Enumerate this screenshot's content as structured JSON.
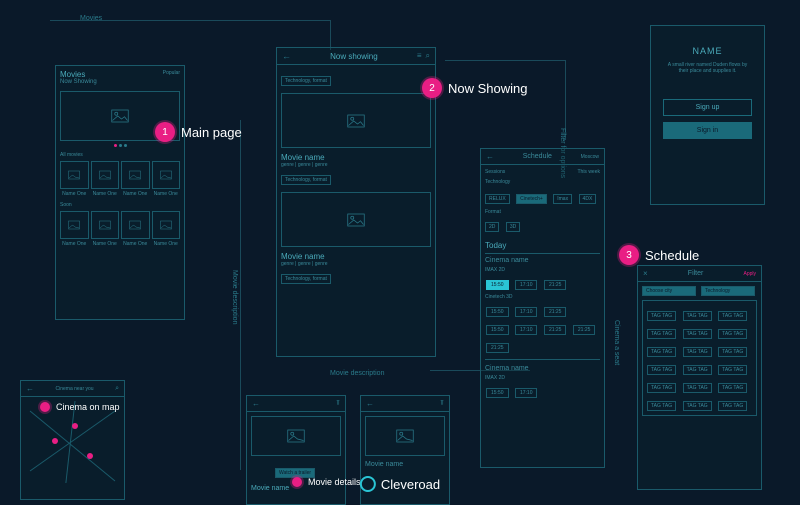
{
  "annotations": {
    "main_page": {
      "num": "1",
      "label": "Main page"
    },
    "now_showing": {
      "num": "2",
      "label": "Now Showing"
    },
    "schedule": {
      "num": "3",
      "label": "Schedule"
    },
    "cinema_on_map": {
      "label": "Cinema on map"
    },
    "movie_details": {
      "label": "Movie details"
    }
  },
  "arrows": {
    "movies": "Movies",
    "filter_for_options": "Filter for options",
    "movie_description_v": "Movie description",
    "movie_description_h": "Movie description",
    "cinema_a_seat": "Cinema a seat"
  },
  "screens": {
    "main": {
      "title": "Movies",
      "subtitle": "Now Showing",
      "right_badge": "Popular",
      "section1": "All movies",
      "section2": "Soon",
      "thumb_label": "Name One"
    },
    "now_showing": {
      "header": "Now showing",
      "chip": "Technology, format",
      "movie_name": "Movie name",
      "genres": "genre  |  genre  |  genre"
    },
    "schedule": {
      "tab": "Schedule",
      "location": "Moscow",
      "sessions": "Sessions",
      "this_week": "This week",
      "tech_label": "Technology",
      "format_label": "Format",
      "tech_opts": [
        "RELUX",
        "Cinetech+",
        "Imax",
        "4DX"
      ],
      "format_opts": [
        "2D",
        "3D"
      ],
      "today": "Today",
      "cinema": "Cinema name",
      "imax_label": "IMAX  2D",
      "cinetech_label": "Cinetech  3D",
      "times_row1": [
        "15:50",
        "17:10",
        "21:25"
      ],
      "times_row2": [
        "15:50",
        "17:10",
        "21:25"
      ],
      "times_row3": [
        "15:50",
        "17:10",
        "21:25",
        "21:25",
        "21:25"
      ]
    },
    "auth": {
      "title": "NAME",
      "tagline": "A small river named Duden flows by their place and supplies it.",
      "signup": "Sign up",
      "signin": "Sign in"
    },
    "details": {
      "watch": "Watch a trailer",
      "movie_name": "Movie name"
    },
    "map": {
      "header": "Cinema near you"
    },
    "filter": {
      "title": "Filter",
      "apply": "Apply",
      "drop1": "Choose city",
      "drop2": "Technology",
      "tag": "TAG TAG"
    }
  },
  "brand": "Cleveroad"
}
